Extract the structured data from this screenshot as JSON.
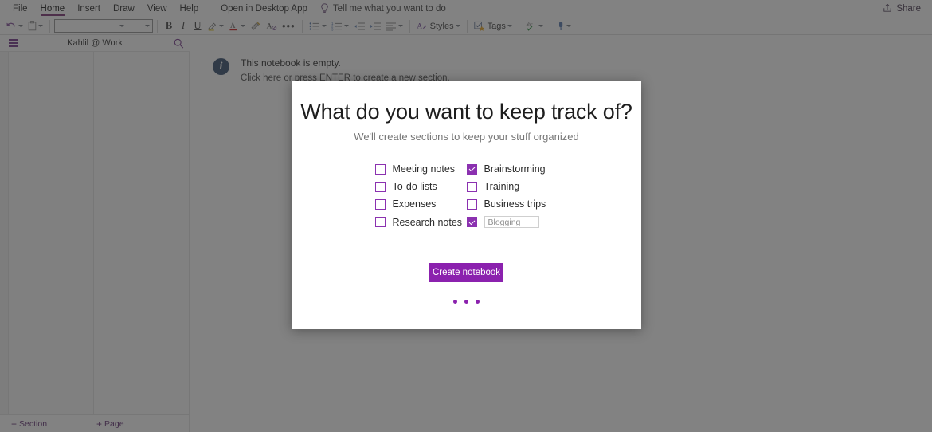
{
  "ribbon": {
    "tabs": [
      {
        "label": "File",
        "active": false
      },
      {
        "label": "Home",
        "active": true
      },
      {
        "label": "Insert",
        "active": false
      },
      {
        "label": "Draw",
        "active": false
      },
      {
        "label": "View",
        "active": false
      },
      {
        "label": "Help",
        "active": false
      }
    ],
    "open_in_desktop": "Open in Desktop App",
    "tell_me": "Tell me what you want to do",
    "tell_me_icon": "lightbulb-icon",
    "share_label": "Share",
    "share_icon": "share-icon",
    "accent_color": "#80397b"
  },
  "toolbar": {
    "undo_icon": "undo-icon",
    "paste_icon": "clipboard-paste-icon",
    "font_name": "",
    "font_size": "",
    "bold": "B",
    "italic": "I",
    "underline": "U",
    "highlight_icon": "highlighter-icon",
    "fontcolor_icon": "font-color-icon",
    "formatpainter_icon": "format-painter-icon",
    "clearformat_icon": "clear-formatting-icon",
    "more_icon": "more-options-icon",
    "bullets_icon": "bulleted-list-icon",
    "numbering_icon": "numbered-list-icon",
    "decrease_indent_icon": "decrease-indent-icon",
    "increase_indent_icon": "increase-indent-icon",
    "align_icon": "align-left-icon",
    "styles_label": "Styles",
    "styles_icon": "styles-icon",
    "tags_label": "Tags",
    "tags_icon": "tag-icon",
    "spelling_icon": "spell-check-icon",
    "immersive_icon": "immersive-reader-icon"
  },
  "notebook": {
    "title": "Kahlil @ Work",
    "menu_icon": "hamburger-menu-icon",
    "search_icon": "search-icon"
  },
  "navbottom": {
    "add_section": "Section",
    "add_page": "Page",
    "plus": "+"
  },
  "canvas": {
    "empty_title": "This notebook is empty.",
    "empty_sub": "Click here or press ENTER to create a new section.",
    "info_icon": "info-icon",
    "info_glyph": "i"
  },
  "dialog": {
    "title": "What do you want to keep track of?",
    "subtitle": "We'll create sections to keep your stuff organized",
    "options_left": [
      {
        "label": "Meeting notes",
        "checked": false
      },
      {
        "label": "To-do lists",
        "checked": false
      },
      {
        "label": "Expenses",
        "checked": false
      },
      {
        "label": "Research notes",
        "checked": false
      }
    ],
    "options_right": [
      {
        "label": "Brainstorming",
        "checked": true
      },
      {
        "label": "Training",
        "checked": false
      },
      {
        "label": "Business trips",
        "checked": false
      }
    ],
    "custom": {
      "checked": true,
      "value": "",
      "placeholder": "Blogging"
    },
    "create_button": "Create notebook",
    "pager_dots": 3,
    "accent_color": "#8b21ae"
  }
}
